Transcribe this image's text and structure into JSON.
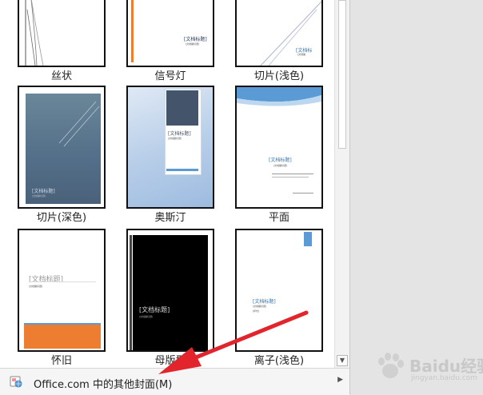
{
  "gallery": {
    "items": [
      {
        "label": "丝状",
        "texts": {}
      },
      {
        "label": "信号灯",
        "texts": {
          "title": "[文档标题]",
          "subtitle": "[文档副标题]"
        }
      },
      {
        "label": "切片(浅色)",
        "texts": {
          "title": "[文档标",
          "subtitle": "[文档副"
        }
      },
      {
        "label": "切片(深色)",
        "texts": {
          "title": "[文档标题]",
          "subtitle": "[文档副标题]"
        }
      },
      {
        "label": "奥斯汀",
        "texts": {
          "title": "[文档标题]",
          "subtitle": "[文档副标题]"
        }
      },
      {
        "label": "平面",
        "texts": {
          "title": "[文档标题]",
          "subtitle": "[文档副标题]"
        }
      },
      {
        "label": "怀旧",
        "texts": {
          "title": "[文档标题]",
          "subtitle": "[文档副标题]"
        }
      },
      {
        "label": "母版型",
        "texts": {
          "title": "[文档标题]",
          "subtitle": "[文档副标题]"
        }
      },
      {
        "label": "离子(浅色)",
        "texts": {
          "title": "[文档标题]",
          "subtitle": "[文档副标题]",
          "year": "[年份]"
        }
      }
    ]
  },
  "footer": {
    "label": "Office.com 中的其他封面(M)",
    "icon": "office-globe-icon"
  },
  "scrollbar": {
    "down_arrow": "▼"
  },
  "watermark": {
    "text": "Baidu经验",
    "url": "jingyan.baidu.com"
  },
  "colors": {
    "accent_orange": "#ed7d31",
    "accent_blue": "#2e75b6",
    "pointer_red": "#e2252c"
  }
}
